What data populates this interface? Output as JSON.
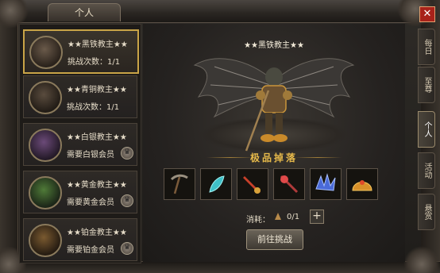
{
  "window": {
    "title": "个人",
    "close": "✕"
  },
  "list": [
    {
      "name": "★★黑铁教主★★",
      "sub": "挑战次数：1/1",
      "vip": false
    },
    {
      "name": "★★青铜教主★★",
      "sub": "挑战次数：1/1",
      "vip": false
    },
    {
      "name": "★★白银教主★★",
      "sub": "需要白银会员",
      "vip": true
    },
    {
      "name": "★★黄金教主★★",
      "sub": "需要黄金会员",
      "vip": true
    },
    {
      "name": "★★铂金教主★★",
      "sub": "需要铂金会员",
      "vip": true
    }
  ],
  "boss": {
    "name": "★★黑铁教主★★"
  },
  "loot": {
    "title": "极品掉落",
    "items": [
      "pickaxe-icon",
      "feather-icon",
      "dagger-icon",
      "staff-icon",
      "claw-icon",
      "helmet-icon"
    ]
  },
  "cost": {
    "label": "消耗：",
    "value": "0/1",
    "plus": "+"
  },
  "challenge": {
    "label": "前往挑战"
  },
  "side_tabs": [
    "每日",
    "至尊",
    "个人",
    "活动",
    "悬赏"
  ],
  "colors": {
    "accent": "#c9a447",
    "close": "#a8221a",
    "loot_title": "#e6b94a"
  }
}
